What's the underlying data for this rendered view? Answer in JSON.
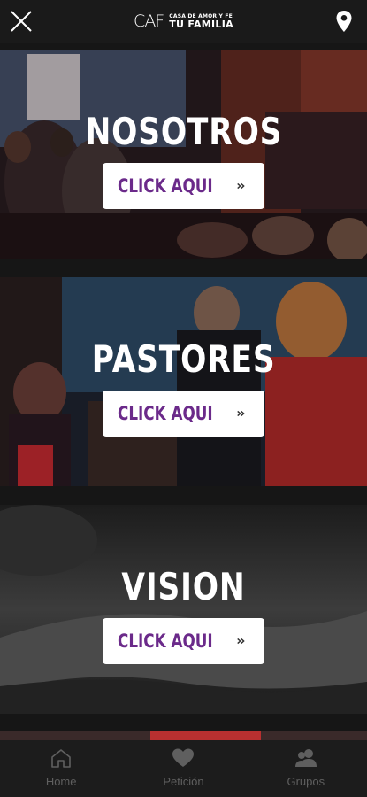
{
  "header": {
    "brand_mark": "CAF",
    "brand_small": "CASA DE AMOR Y FE",
    "brand_big": "TU FAMILIA"
  },
  "sections": [
    {
      "title": "NOSOTROS",
      "button_label": "CLICK AQUI"
    },
    {
      "title": "PASTORES",
      "button_label": "CLICK AQUI"
    },
    {
      "title": "VISION",
      "button_label": "CLICK AQUI"
    }
  ],
  "bottom_nav": [
    {
      "label": "Home",
      "icon": "home-icon"
    },
    {
      "label": "Petición",
      "icon": "heart-icon"
    },
    {
      "label": "Grupos",
      "icon": "group-icon"
    }
  ],
  "colors": {
    "accent": "#6b2a8a",
    "nav_inactive": "#5f5f5f",
    "header_bg": "#1a1a1a"
  }
}
